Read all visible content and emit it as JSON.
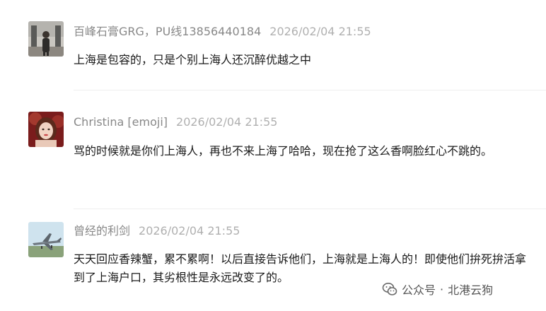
{
  "comments": [
    {
      "author": "百峰石膏GRG，PU线13856440184",
      "time": "2026/02/04 21:55",
      "text": "上海是包容的，只是个别上海人还沉醉优越之中",
      "avatar_icon": "person-photo"
    },
    {
      "author": "Christina [emoji]",
      "time": "2026/02/04 21:55",
      "text": "骂的时候就是你们上海人，再也不来上海了哈哈，现在抢了这么香啊脸红心不跳的。",
      "avatar_icon": "woman-portrait"
    },
    {
      "author": "曾经的利剑",
      "time": "2026/02/04 21:55",
      "text": "天天回应香辣蟹，累不累啊！以后直接告诉他们，上海就是上海人的！即使他们拚死拚活拿到了上海户口，其劣根性是永远改变了的。",
      "avatar_icon": "fighter-jet"
    }
  ],
  "watermark": {
    "icon": "wechat-icon",
    "label": "公众号",
    "separator": "·",
    "account": "北港云狗"
  }
}
